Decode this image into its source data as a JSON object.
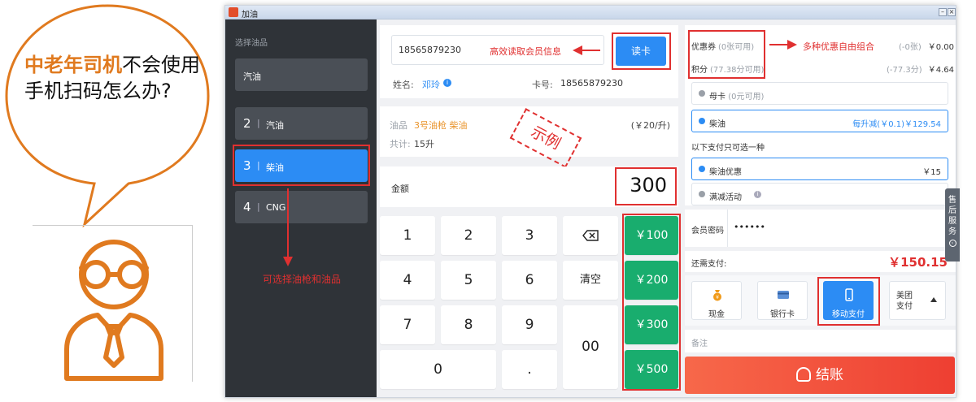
{
  "bubble": {
    "highlight": "中老年司机",
    "rest": "不会使用手机扫码怎么办?"
  },
  "window": {
    "title": "加油"
  },
  "fuel_panel": {
    "caption": "选择油品",
    "items": [
      {
        "num": "",
        "name": "汽油"
      },
      {
        "num": "2",
        "name": "汽油"
      },
      {
        "num": "3",
        "name": "柴油"
      },
      {
        "num": "4",
        "name": "CNG"
      }
    ],
    "annotation": "可选择油枪和油品"
  },
  "member": {
    "phone_value": "18565879230",
    "annotation": "高效读取会员信息",
    "read_card_label": "读卡",
    "name_label": "姓名:",
    "name_value": "邓玲",
    "card_label": "卡号:",
    "card_value": "18565879230"
  },
  "fuel_info": {
    "label": "油品",
    "value": "3号油枪 柴油",
    "price": "(￥20/升)",
    "total_label": "共计:",
    "total_value": "15升",
    "stamp": "示例"
  },
  "amount": {
    "label": "金额",
    "value": "300"
  },
  "keypad": {
    "keys": [
      "1",
      "2",
      "3",
      "4",
      "5",
      "6",
      "7",
      "8",
      "9",
      "0",
      ".",
      "00"
    ],
    "clear_label": "清空",
    "quick": [
      "￥100",
      "￥200",
      "￥300",
      "￥500"
    ]
  },
  "discounts": {
    "coupon_label": "优惠券",
    "coupon_sub": "(0张可用)",
    "coupon_deduct": "(-0张)",
    "coupon_amount": "￥0.00",
    "points_label": "积分",
    "points_sub": "(77.38分可用)",
    "points_deduct": "(-77.3分)",
    "points_amount": "￥4.64",
    "annotation": "多种优惠自由组合",
    "cards": [
      {
        "label": "母卡",
        "sub": "(0元可用)",
        "value": ""
      },
      {
        "label": "柴油",
        "sub": "",
        "value": "每升减(￥0.1)￥129.54"
      }
    ],
    "exclusive_caption": "以下支付只可选一种",
    "promos": [
      {
        "label": "柴油优惠",
        "value": "￥15"
      },
      {
        "label": "满减活动",
        "value": ""
      }
    ]
  },
  "password": {
    "label": "会员密码",
    "value": "••••••"
  },
  "due": {
    "label": "还需支付:",
    "value": "￥150.15"
  },
  "payment": {
    "methods": [
      "现金",
      "银行卡",
      "移动支付"
    ],
    "more_label_1": "美团",
    "more_label_2": "支付"
  },
  "remark": {
    "placeholder": "备注"
  },
  "checkout": {
    "label": "结账"
  },
  "service_tab": {
    "chars": [
      "售",
      "后",
      "服",
      "务"
    ]
  },
  "colors": {
    "accent": "#2c8cf4",
    "green": "#19ad6e",
    "red": "#e03030",
    "orange": "#e07a1f",
    "checkout": "#f04f3d"
  }
}
